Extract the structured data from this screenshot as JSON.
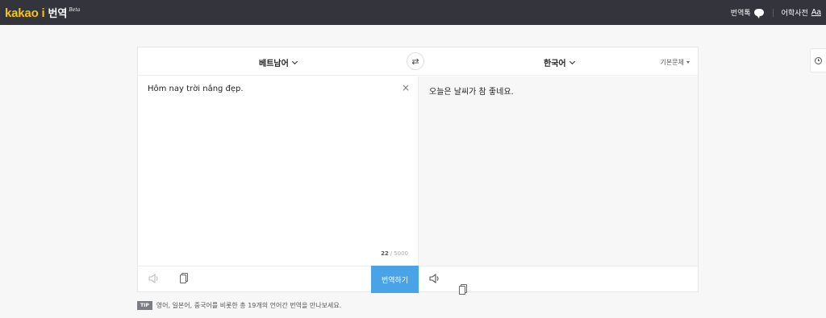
{
  "header": {
    "logo_brand": "kakao i",
    "logo_service": "번역",
    "logo_beta": "Beta",
    "link_translation_talk": "번역톡",
    "link_dictionary": "어학사전",
    "dictionary_icon": "Aa"
  },
  "translator": {
    "source_lang": "베트남어",
    "target_lang": "한국어",
    "style": "기본문체",
    "swap_icon": "⇄",
    "source_text": "Hôm nay trời nắng đẹp.",
    "target_text": "오늘은 날씨가 참 좋네요.",
    "char_count_current": "22",
    "char_count_sep": "/",
    "char_count_max": "5000",
    "translate_button": "번역하기",
    "clear_icon": "×"
  },
  "tip": {
    "badge": "TIP",
    "text": "영어, 일본어, 중국어를 비롯한 총 19개의 언어간 번역을 만나보세요."
  },
  "colors": {
    "topbar": "#33343c",
    "brand_yellow": "#f5c21b",
    "accent_blue": "#4aa3e6"
  },
  "icons": [
    "chat-bubble-icon",
    "swap-icon",
    "close-icon",
    "speaker-icon",
    "copy-icon",
    "clock-icon",
    "chevron-down-icon"
  ]
}
